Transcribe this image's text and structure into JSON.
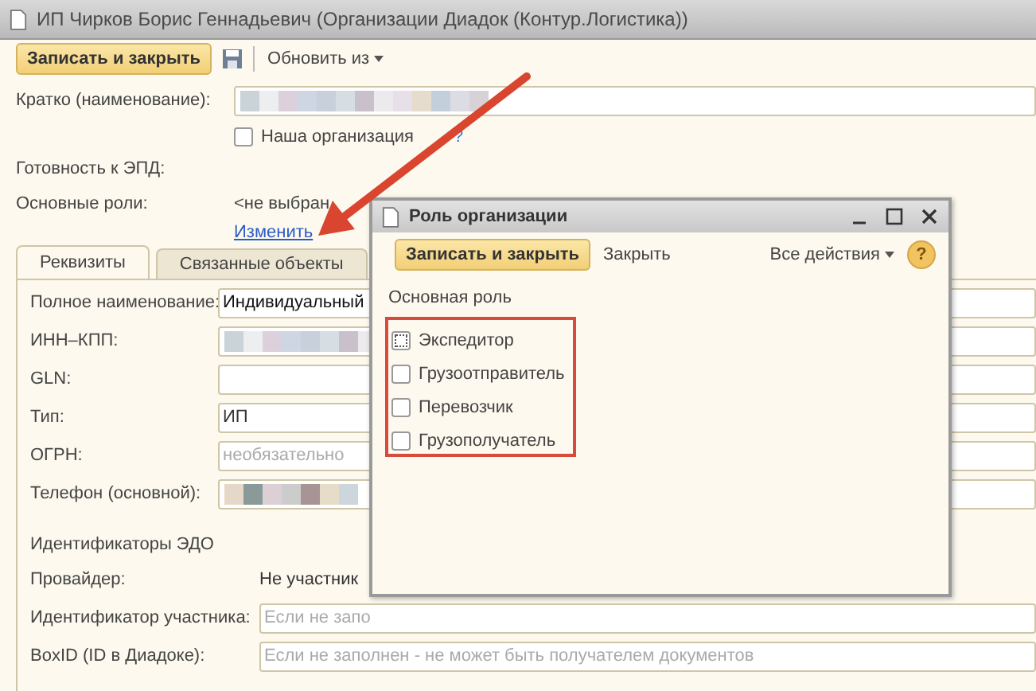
{
  "window": {
    "title": "ИП Чирков Борис Геннадьевич (Организации Диадок (Контур.Логистика))"
  },
  "toolbar": {
    "save_close": "Записать и закрыть",
    "update": "Обновить из"
  },
  "short_name": {
    "label": "Кратко (наименование):"
  },
  "our_org": {
    "label": "Наша организация",
    "checked": false,
    "help": "?"
  },
  "edo_ready": {
    "label": "Готовность к ЭПД:"
  },
  "roles": {
    "label": "Основные роли:",
    "value": "<не выбран",
    "link": "Изменить"
  },
  "tabs": [
    {
      "label": "Реквизиты",
      "selected": true
    },
    {
      "label": "Связанные объекты",
      "selected": false
    }
  ],
  "fields": [
    {
      "label": "Полное наименование:",
      "kind": "text",
      "value": "Индивидуальный"
    },
    {
      "label": "ИНН–КПП:",
      "kind": "redacted"
    },
    {
      "label": "GLN:",
      "kind": "text"
    },
    {
      "label": "Тип:",
      "kind": "text",
      "value": "ИП"
    },
    {
      "label": "ОГРН:",
      "kind": "text",
      "placeholder": "необязательно"
    },
    {
      "label": "Телефон (основной):",
      "kind": "redacted"
    }
  ],
  "edo": {
    "heading": "Идентификаторы ЭДО",
    "provider_label": "Провайдер:",
    "provider_value": "Не участник",
    "fields": [
      {
        "label": "Идентификатор участника:",
        "placeholder": "Если не запо"
      },
      {
        "label": "BoxID (ID в Диадоке):",
        "placeholder": "Если не заполнен - не может быть получателем документов"
      }
    ]
  },
  "dialog": {
    "title": "Роль организации",
    "save_close": "Записать и закрыть",
    "close": "Закрыть",
    "actions": "Все действия",
    "help": "?",
    "section": "Основная роль",
    "roles": [
      {
        "label": "Экспедитор",
        "checked": false
      },
      {
        "label": "Грузоотправитель",
        "checked": false
      },
      {
        "label": "Перевозчик",
        "checked": false
      },
      {
        "label": "Грузополучатель",
        "checked": false
      }
    ]
  }
}
